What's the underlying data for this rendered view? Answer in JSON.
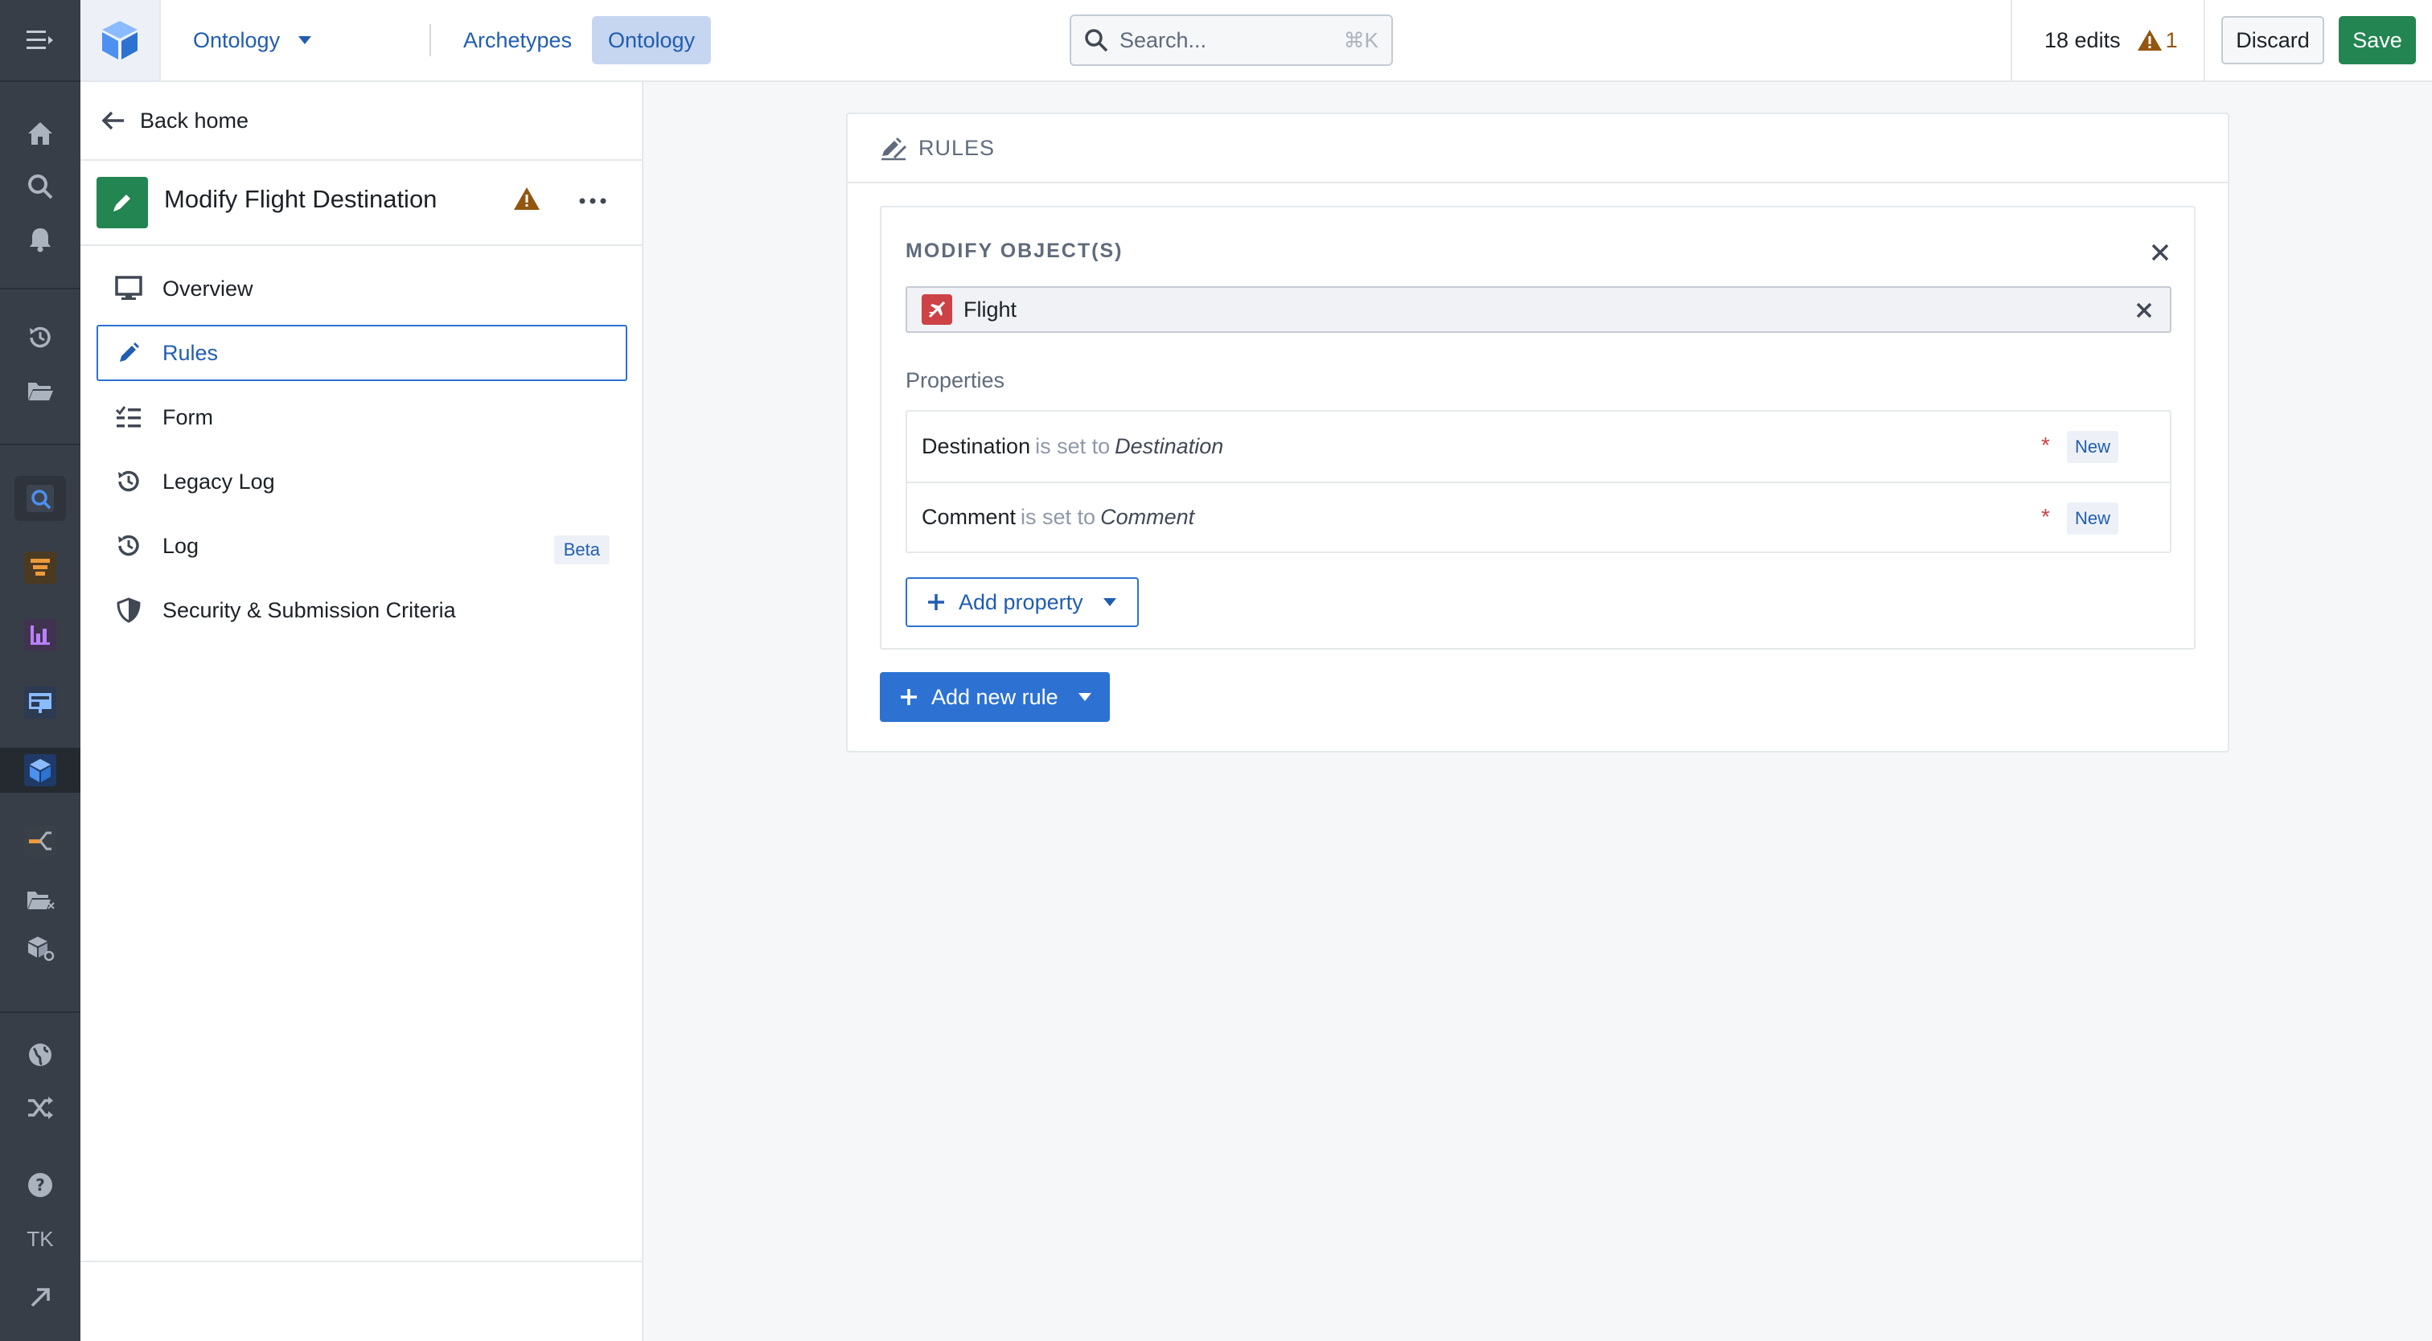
{
  "colors": {
    "rail_bg": "#383e47",
    "accent": "#2d72d2",
    "save_green": "#238551",
    "warning": "#935610",
    "danger": "#cd4246"
  },
  "topbar": {
    "app_name": "Ontology",
    "tabs": [
      {
        "label": "Archetypes",
        "active": false
      },
      {
        "label": "Ontology",
        "active": true
      }
    ],
    "search": {
      "placeholder": "Search...",
      "shortcut": "⌘K"
    },
    "edits_label": "18 edits",
    "warning_count": "1",
    "discard_label": "Discard",
    "save_label": "Save"
  },
  "rail": {
    "icons": [
      "menu-icon",
      "home-icon",
      "search-icon",
      "notifications-icon",
      "history-icon",
      "folder-icon",
      "quiver-icon",
      "pipeline-icon",
      "charts-icon",
      "workshop-icon",
      "ontology-icon",
      "graph-icon",
      "files-icon",
      "object-explorer-icon",
      "globe-icon",
      "shuffle-icon",
      "help-icon",
      "arrow-up-right-icon"
    ],
    "user_initials": "TK"
  },
  "sidebar": {
    "back_label": "Back home",
    "action_title": "Modify Flight Destination",
    "nav": [
      {
        "label": "Overview",
        "icon": "monitor-icon",
        "active": false
      },
      {
        "label": "Rules",
        "icon": "edit-icon",
        "active": true
      },
      {
        "label": "Form",
        "icon": "form-icon",
        "active": false
      },
      {
        "label": "Legacy Log",
        "icon": "history-icon",
        "active": false
      },
      {
        "label": "Log",
        "icon": "history-icon",
        "active": false,
        "badge": "Beta"
      },
      {
        "label": "Security & Submission Criteria",
        "icon": "shield-icon",
        "active": false
      }
    ]
  },
  "main": {
    "section_title": "RULES",
    "rule": {
      "title": "MODIFY OBJECT(S)",
      "object": "Flight",
      "properties_label": "Properties",
      "properties": [
        {
          "name": "Destination",
          "connector": "is set to",
          "value": "Destination",
          "required": "*",
          "badge": "New"
        },
        {
          "name": "Comment",
          "connector": "is set to",
          "value": "Comment",
          "required": "*",
          "badge": "New"
        }
      ],
      "add_property_label": "Add property"
    },
    "add_rule_label": "Add new rule"
  }
}
